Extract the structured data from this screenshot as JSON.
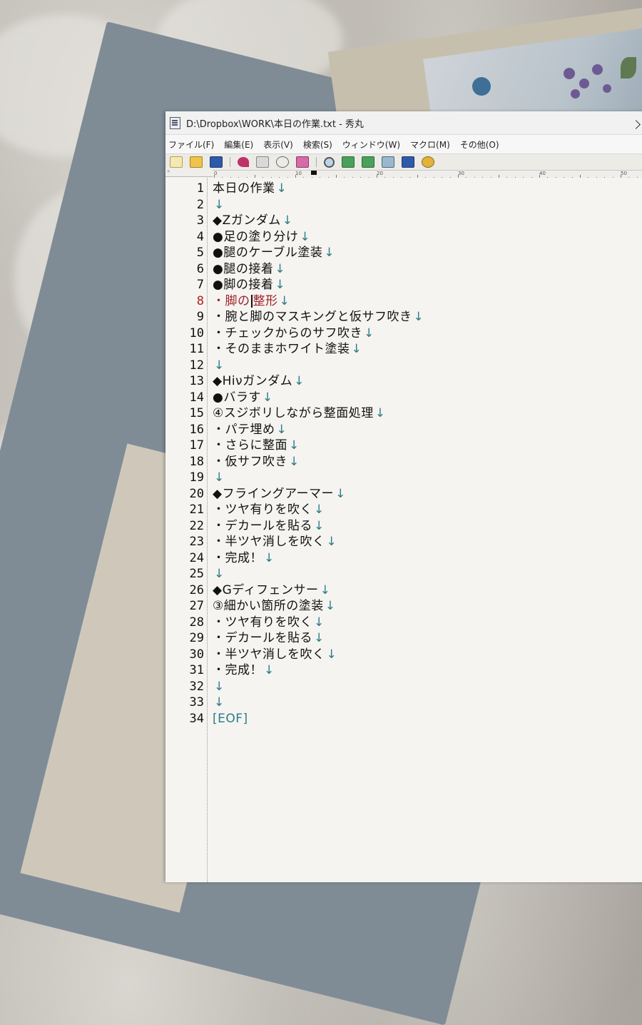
{
  "window": {
    "title": "D:\\Dropbox\\WORK\\本日の作業.txt  - 秀丸"
  },
  "menu": [
    "ファイル(F)",
    "編集(E)",
    "表示(V)",
    "検索(S)",
    "ウィンドウ(W)",
    "マクロ(M)",
    "その他(O)"
  ],
  "toolbar": [
    "new-file-icon",
    "open-folder-icon",
    "save-icon",
    "undo-icon",
    "window-icon",
    "cut-icon",
    "copy-icon",
    "search-icon",
    "find-next-down-icon",
    "find-next-up-icon",
    "grep-icon",
    "split-window-icon",
    "help-icon"
  ],
  "ruler": {
    "labels": [
      "0",
      "10",
      "20",
      "30",
      "40",
      "50"
    ]
  },
  "editor": {
    "line_end_mark": "↓",
    "eof_mark": "[EOF]",
    "current_line": 8,
    "lines": [
      "本日の作業",
      "",
      "◆Zガンダム",
      "●足の塗り分け",
      "●腿のケーブル塗装",
      "●腿の接着",
      "●脚の接着",
      "・脚の整形",
      "・腕と脚のマスキングと仮サフ吹き",
      "・チェックからのサフ吹き",
      "・そのままホワイト塗装",
      "",
      "◆Hiνガンダム",
      "●バラす",
      "④スジボリしながら整面処理",
      "・パテ埋め",
      "・さらに整面",
      "・仮サフ吹き",
      "",
      "◆フライングアーマー",
      "・ツヤ有りを吹く",
      "・デカールを貼る",
      "・半ツヤ消しを吹く",
      "・完成！",
      "",
      "◆Gディフェンサー",
      "③細かい箇所の塗装",
      "・ツヤ有りを吹く",
      "・デカールを貼る",
      "・半ツヤ消しを吹く",
      "・完成！",
      "",
      ""
    ]
  }
}
